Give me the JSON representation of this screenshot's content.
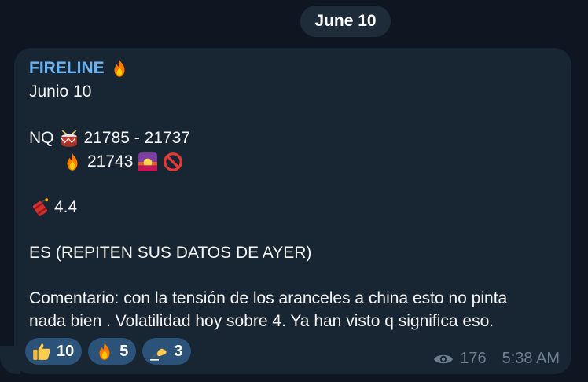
{
  "date_pill": "June 10",
  "message": {
    "sender": "FIRELINE",
    "lines": {
      "date": "Junio 10",
      "nq_label": "NQ",
      "nq_range": "21785 - 21737",
      "nq_level": "21743",
      "value": "4.4",
      "es": "ES (REPITEN SUS DATOS DE AYER)",
      "comment_1": "Comentario: con la tensión de los aranceles a china esto no pinta",
      "comment_2": "nada bien . Volatilidad hoy sobre 4. Ya han visto q significa eso."
    }
  },
  "reactions": [
    {
      "emoji": "thumbs-up",
      "count": "10"
    },
    {
      "emoji": "fire",
      "count": "5"
    },
    {
      "emoji": "writing-hand",
      "count": "3"
    }
  ],
  "meta": {
    "views": "176",
    "time": "5:38 AM"
  },
  "colors": {
    "background": "#0e1621",
    "bubble": "#182533",
    "sender": "#6ab3f3",
    "reaction_bg": "#2b5278",
    "meta": "#6d7f8f"
  }
}
